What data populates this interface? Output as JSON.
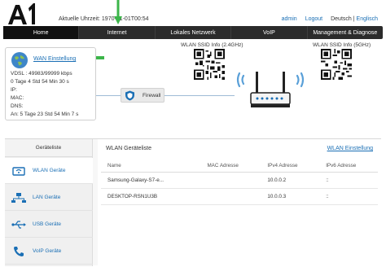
{
  "header": {
    "logo_text": "A1",
    "time_label": "Aktuelle Uhrzeit: 1970-01-01T00:54",
    "links": {
      "admin": "admin",
      "logout": "Logout",
      "deutsch": "Deutsch",
      "sep": "|",
      "english": "Englisch"
    }
  },
  "nav": {
    "items": [
      "Home",
      "Internet",
      "Lokales Netzwerk",
      "VoIP",
      "Management & Diagnose"
    ]
  },
  "wan": {
    "link": "WAN Einstellung",
    "vdsl": "VDSL : 49983/99999 kbps",
    "uptime": "0 Tage 4 Std 54 Min 30 s",
    "ip": "IP:",
    "mac": "MAC:",
    "dns": "DNS:",
    "an": "An: 5 Tage 23 Std 54 Min 7 s"
  },
  "firewall": {
    "label": "Firewall"
  },
  "wlan": {
    "ssid_24": "WLAN SSID Info (2.4GHz)",
    "ssid_5": "WLAN SSID Info (5GHz)"
  },
  "devices": {
    "sidebar_title": "Geräteliste",
    "sidebar": [
      "WLAN Geräte",
      "LAN Geräte",
      "USB Geräte",
      "VoIP Geräte"
    ],
    "title": "WLAN Geräteliste",
    "settings_link": "WLAN Einstellung",
    "columns": [
      "Name",
      "MAC Adresse",
      "IPv4 Adresse",
      "IPv6 Adresse"
    ],
    "rows": [
      {
        "name": "Samsung-Galaxy-S7-e...",
        "mac": "",
        "ipv4": "10.0.0.2",
        "ipv6": "::"
      },
      {
        "name": "DESKTOP-RSN1U3B",
        "mac": "",
        "ipv4": "10.0.0.3",
        "ipv6": "::"
      }
    ]
  },
  "colors": {
    "accent": "#1a6fb5",
    "nav_bg": "#2b2b2b",
    "highlight_arrow": "#3cb54a",
    "wifi": "#5aa0d8"
  }
}
